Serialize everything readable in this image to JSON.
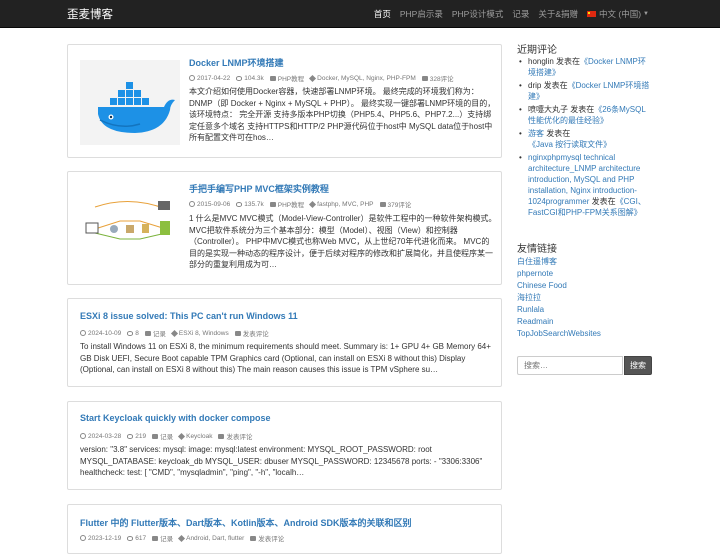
{
  "navbar": {
    "brand": "歪麦博客",
    "items": [
      {
        "label": "首页",
        "active": true
      },
      {
        "label": "PHP启示录"
      },
      {
        "label": "PHP设计模式"
      },
      {
        "label": "记录"
      },
      {
        "label": "关于&捐赠"
      },
      {
        "label": "中文 (中国)"
      }
    ]
  },
  "posts": [
    {
      "title": "Docker LNMP环境搭建",
      "date": "2017-04-22",
      "views": "104.3k",
      "category": "PHP教程",
      "tags": "Docker, MySQL, Nginx, PHP-FPM",
      "comments": "328评论",
      "excerpt": "本文介绍如何使用Docker容器，快速部署LNMP环境。 最终完成的环境我们称为：DNMP（即 Docker + Nginx + MySQL + PHP）。 最终实现一键部署LNMP环境的目的，该环境特点： 完全开源 支持多版本PHP切换（PHP5.4、PHP5.6、PHP7.2...）支持绑定任意多个域名 支持HTTPS和HTTP/2 PHP源代码位于host中 MySQL data位于host中 所有配置文件可在hos…",
      "thumb_icon": "docker-whale-image"
    },
    {
      "title": "手把手编写PHP MVC框架实例教程",
      "date": "2015-09-06",
      "views": "135.7k",
      "category": "PHP教程",
      "tags": "fastphp, MVC, PHP",
      "comments": "379评论",
      "excerpt": "1 什么是MVC MVC模式（Model-View-Controller）是软件工程中的一种软件架构模式。 MVC把软件系统分为三个基本部分：模型（Model）、视图（View）和控制器（Controller）。 PHP中MVC模式也称Web MVC，从上世纪70年代进化而来。 MVC的目的是实现一种动态的程序设计，便于后续对程序的修改和扩展简化，并且使程序某一部分的重复利用成为可…",
      "thumb_icon": "mvc-diagram-image"
    },
    {
      "title": "ESXi 8 issue solved: This PC can't run Windows 11",
      "date": "2024-10-09",
      "views": "8",
      "category": "记录",
      "tags": "ESXi 8, Windows",
      "comments": "发表评论",
      "excerpt": "To install Windows 11 on ESXi 8, the minimum requirements should meet. Summary is: 1+ GPU 4+ GB Memory 64+ GB Disk UEFI, Secure Boot capable TPM Graphics card (Optional, can install on ESXi 8 without this) Display (Optional, can install on ESXi 8 without this) The main reason causes this issue is TPM vSphere su…"
    },
    {
      "title": "Start Keycloak quickly with docker compose",
      "date": "2024-03-28",
      "views": "219",
      "category": "记录",
      "tags": "Keycloak",
      "comments": "发表评论",
      "excerpt": "version: \"3.8\" services: mysql: image: mysql:latest environment: MYSQL_ROOT_PASSWORD: root MYSQL_DATABASE: keycloak_db MYSQL_USER: dbuser MYSQL_PASSWORD: 12345678 ports: - \"3306:3306\" healthcheck: test: [ \"CMD\", \"mysqladmin\", \"ping\", \"-h\", \"localh…"
    },
    {
      "title": "Flutter 中的 Flutter版本、Dart版本、Kotlin版本、Android SDK版本的关联和区别",
      "date": "2023-12-19",
      "views": "617",
      "category": "记录",
      "tags": "Android, Dart, flutter",
      "comments": "发表评论"
    }
  ],
  "sidebar": {
    "recent_heading": "近期评论",
    "recent": [
      {
        "author": "honglin",
        "verb": "发表在",
        "post": "《Docker LNMP环境搭建》",
        "author_link": false
      },
      {
        "author": "drip",
        "verb": "发表在",
        "post": "《Docker LNMP环境搭建》",
        "author_link": false
      },
      {
        "author": "喷嚏大丸子",
        "verb": "发表在",
        "post": "《26条MySQL性能优化的最佳经验》",
        "author_link": false
      },
      {
        "author": "游客",
        "verb": "发表在",
        "post": "《Java 按行读取文件》",
        "author_link": true
      },
      {
        "author": "nginxphpmysql technical architecture_LNMP architecture introduction, MySQL and PHP installation, Nginx introduction-1024programmer",
        "verb": "发表在",
        "post": "《CGI、FastCGI和PHP-FPM关系图解》",
        "author_link": true
      }
    ],
    "links_heading": "友情链接",
    "links": [
      "白住遥博客",
      "phpernote",
      "Chinese Food",
      "海拉拉",
      "Runlala",
      "Readmain",
      "TopJobSearchWebsites"
    ],
    "search": {
      "placeholder": "搜索…",
      "button": "搜索"
    }
  }
}
